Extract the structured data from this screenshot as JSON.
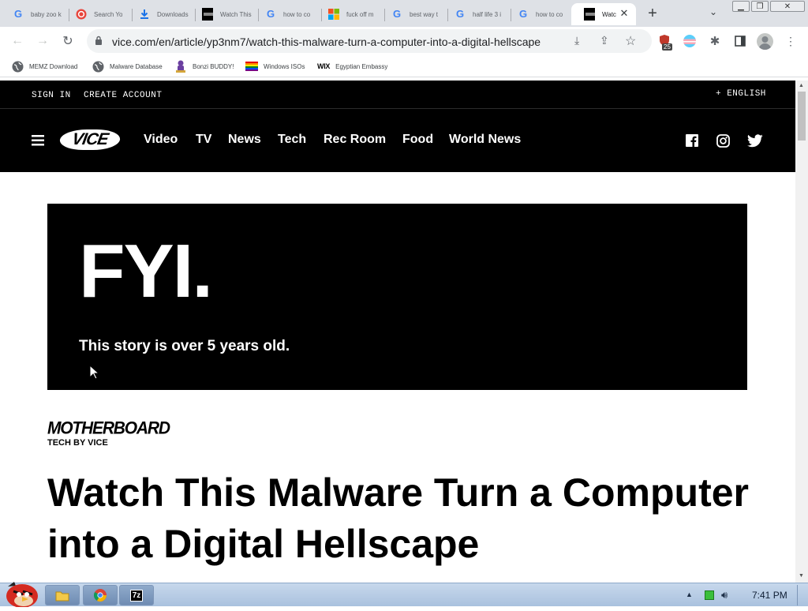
{
  "browser": {
    "tabs": [
      {
        "title": "baby zoo k",
        "icon": "google-icon"
      },
      {
        "title": "Search Yo",
        "icon": "search-site-icon"
      },
      {
        "title": "Downloads",
        "icon": "download-icon"
      },
      {
        "title": "Watch This",
        "icon": "vice-favicon-icon"
      },
      {
        "title": "how to co",
        "icon": "google-icon"
      },
      {
        "title": "fuck off m",
        "icon": "microsoft-icon"
      },
      {
        "title": "best way t",
        "icon": "google-icon"
      },
      {
        "title": "half life 3 i",
        "icon": "google-icon"
      },
      {
        "title": "how to co",
        "icon": "google-icon"
      },
      {
        "title": "Watc",
        "icon": "vice-favicon-icon",
        "active": true
      }
    ],
    "url": "vice.com/en/article/yp3nm7/watch-this-malware-turn-a-computer-into-a-digital-hellscape",
    "extension_badge": "25",
    "bookmarks": [
      {
        "label": "MEMZ Download",
        "icon": "globe-icon"
      },
      {
        "label": "Malware Database",
        "icon": "globe-icon"
      },
      {
        "label": "Bonzi BUDDY!",
        "icon": "bonzi-icon"
      },
      {
        "label": "Windows ISOs",
        "icon": "rainbow-flag-icon"
      },
      {
        "label": "Egyptian Embassy",
        "icon": "wix-icon",
        "logo": "WIX"
      }
    ]
  },
  "site": {
    "topbar": {
      "sign_in": "SIGN IN",
      "create_account": "CREATE ACCOUNT",
      "language": "+ ENGLISH"
    },
    "logo": "VICE",
    "nav": [
      "Video",
      "TV",
      "News",
      "Tech",
      "Rec Room",
      "Food",
      "World News"
    ]
  },
  "article": {
    "fyi_title": "FYI.",
    "fyi_subtitle": "This story is over 5 years old.",
    "section_logo": "MOTHERBOARD",
    "section_tagline": "TECH BY VICE",
    "headline": "Watch This Malware Turn a Computer into a Digital Hellscape"
  },
  "taskbar": {
    "clock": "7:41 PM",
    "app_label": "7z"
  },
  "colors": {
    "accent_black": "#000000",
    "tab_strip": "#dee1e6",
    "taskbar": "#b8cde6"
  }
}
